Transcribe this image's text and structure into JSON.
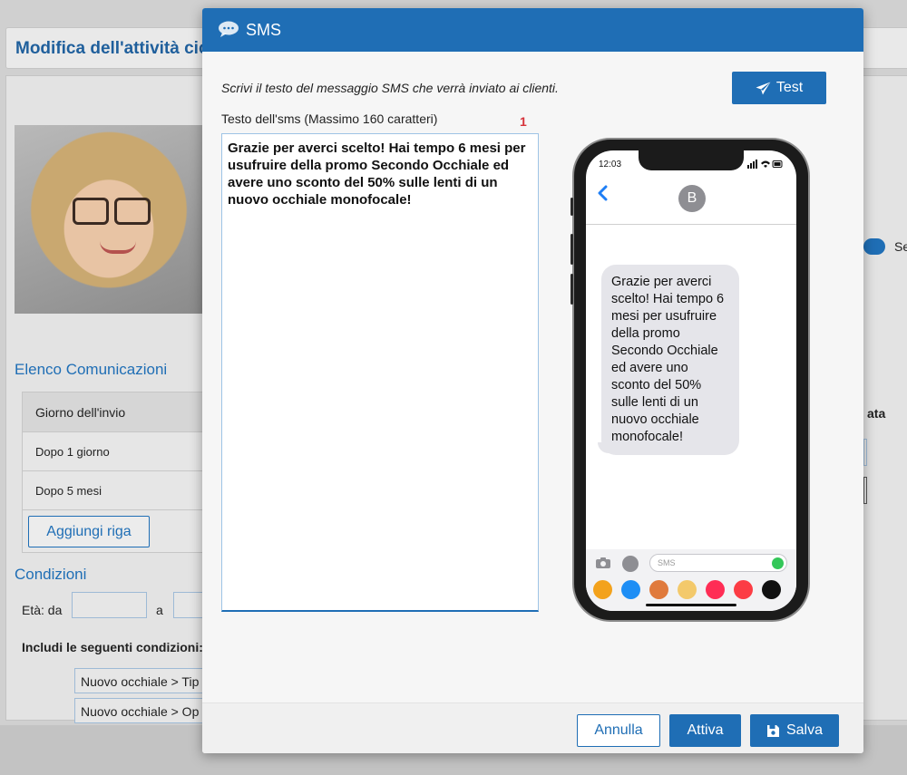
{
  "background": {
    "page_title": "Modifica dell'attività cicli",
    "section_communications": "Elenco Comunicazioni",
    "table_header": "Giorno dell'invio",
    "table_rows": [
      "Dopo 1 giorno",
      "Dopo 5 mesi"
    ],
    "add_row_label": "Aggiungi riga",
    "section_conditions": "Condizioni",
    "age_from_label": "Età: da",
    "age_to_label": "a",
    "include_label": "Includi le seguenti condizioni:",
    "condition_chips": [
      "Nuovo occhiale > Tip",
      "Nuovo occhiale > Op"
    ],
    "right_header_fragment": "ata",
    "right_toggle_fragment": "Se"
  },
  "modal": {
    "title": "SMS",
    "instructions": "Scrivi il testo del messaggio SMS che verrà inviato ai clienti.",
    "test_button": "Test",
    "field_label": "Testo dell'sms (Massimo 160 caratteri)",
    "counter": "1",
    "sms_text": "Grazie per averci scelto! Hai tempo 6 mesi per usufruire della promo Secondo Occhiale ed avere uno sconto del 50% sulle lenti di un nuovo occhiale monofocale!",
    "footer": {
      "cancel": "Annulla",
      "activate": "Attiva",
      "save": "Salva"
    }
  },
  "phone": {
    "time": "12:03",
    "contact_initial": "B",
    "input_placeholder": "SMS",
    "app_colors": [
      "#f3a21c",
      "#1e8ef5",
      "#e07a3c",
      "#f3c96b",
      "#ff2d55",
      "#fc3c44",
      "#111111",
      "#ff3b30"
    ]
  },
  "colors": {
    "primary": "#1f6eb5",
    "counter_red": "#d6323a",
    "bubble_gray": "#e5e5ea"
  }
}
